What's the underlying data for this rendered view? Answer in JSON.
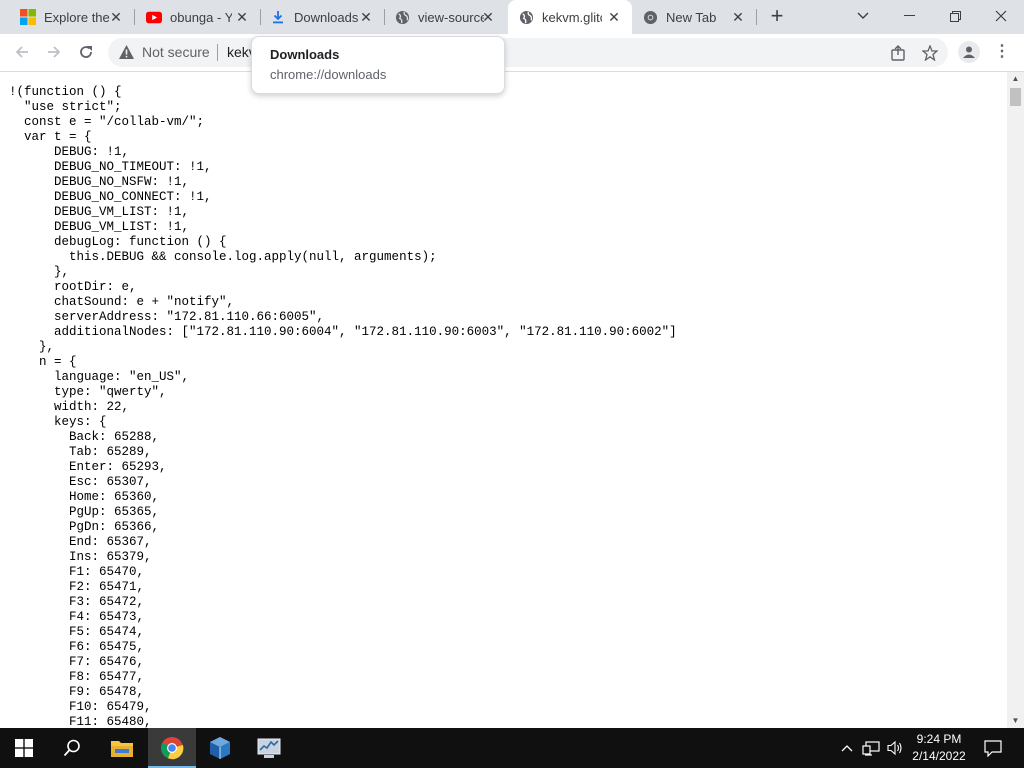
{
  "browser": {
    "tabs": [
      {
        "title": "Explore the",
        "icon": "microsoft-icon",
        "active": false
      },
      {
        "title": "obunga - Y",
        "icon": "youtube-icon",
        "active": false
      },
      {
        "title": "Downloads",
        "icon": "download-icon",
        "active": false
      },
      {
        "title": "view-source",
        "icon": "globe-icon",
        "active": false
      },
      {
        "title": "kekvm.glitc",
        "icon": "globe-icon",
        "active": true
      },
      {
        "title": "New Tab",
        "icon": "chrome-icon",
        "active": false
      }
    ],
    "tooltip": {
      "title": "Downloads",
      "url": "chrome://downloads"
    },
    "address_bar": {
      "security_label": "Not secure",
      "url": "kekv"
    }
  },
  "page": {
    "code_lines": [
      "!(function () {",
      "  \"use strict\";",
      "  const e = \"/collab-vm/\";",
      "  var t = {",
      "      DEBUG: !1,",
      "      DEBUG_NO_TIMEOUT: !1,",
      "      DEBUG_NO_NSFW: !1,",
      "      DEBUG_NO_CONNECT: !1,",
      "      DEBUG_VM_LIST: !1,",
      "      DEBUG_VM_LIST: !1,",
      "      debugLog: function () {",
      "        this.DEBUG && console.log.apply(null, arguments);",
      "      },",
      "      rootDir: e,",
      "      chatSound: e + \"notify\",",
      "      serverAddress: \"172.81.110.66:6005\",",
      "      additionalNodes: [\"172.81.110.90:6004\", \"172.81.110.90:6003\", \"172.81.110.90:6002\"]",
      "    },",
      "    n = {",
      "      language: \"en_US\",",
      "      type: \"qwerty\",",
      "      width: 22,",
      "      keys: {",
      "        Back: 65288,",
      "        Tab: 65289,",
      "        Enter: 65293,",
      "        Esc: 65307,",
      "        Home: 65360,",
      "        PgUp: 65365,",
      "        PgDn: 65366,",
      "        End: 65367,",
      "        Ins: 65379,",
      "        F1: 65470,",
      "        F2: 65471,",
      "        F3: 65472,",
      "        F4: 65473,",
      "        F5: 65474,",
      "        F6: 65475,",
      "        F7: 65476,",
      "        F8: 65477,",
      "        F9: 65478,",
      "        F10: 65479,",
      "        F11: 65480,"
    ]
  },
  "taskbar": {
    "pinned": [
      "file-explorer-icon",
      "chrome-icon",
      "virtualbox-icon",
      "system-monitor-icon"
    ],
    "clock": {
      "time": "9:24 PM",
      "date": "2/14/2022"
    }
  },
  "colors": {
    "tabstrip": "#dee1e6",
    "taskbar": "#101010",
    "accent": "#1a73e8"
  }
}
